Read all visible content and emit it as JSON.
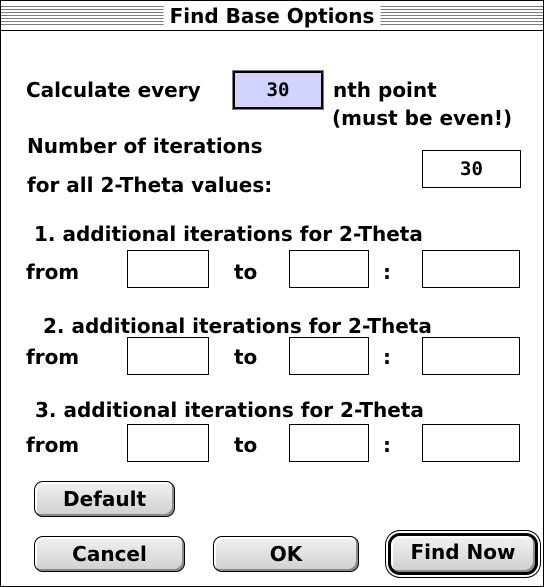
{
  "window": {
    "title": "Find Base Options"
  },
  "calc": {
    "label": "Calculate every",
    "value": "30",
    "suffix": "nth point",
    "note": "(must be even!)"
  },
  "iterations": {
    "label_line1": "Number of iterations",
    "label_line2": "for all 2-Theta values:",
    "value": "30"
  },
  "ranges": [
    {
      "heading": "1. additional iterations for 2-Theta",
      "from_label": "from",
      "to_label": "to",
      "colon": ":",
      "from_value": "",
      "to_value": "",
      "iter_value": ""
    },
    {
      "heading": "2. additional iterations for 2-Theta",
      "from_label": "from",
      "to_label": "to",
      "colon": ":",
      "from_value": "",
      "to_value": "",
      "iter_value": ""
    },
    {
      "heading": "3. additional iterations for 2-Theta",
      "from_label": "from",
      "to_label": "to",
      "colon": ":",
      "from_value": "",
      "to_value": "",
      "iter_value": ""
    }
  ],
  "buttons": {
    "default_label": "Default",
    "cancel_label": "Cancel",
    "ok_label": "OK",
    "find_now_label": "Find Now"
  }
}
